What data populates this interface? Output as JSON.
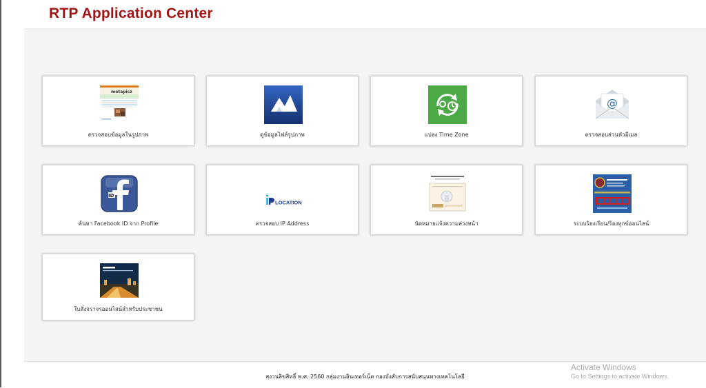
{
  "header": {
    "title": "RTP Application Center"
  },
  "apps": [
    {
      "label": "ตรวจสอบข้อมูลในรูปภาพ",
      "icon": "image-metadata-thumbnail-icon"
    },
    {
      "label": "ดูข้อมูลไฟล์รูปภาพ",
      "icon": "mountain-photo-icon"
    },
    {
      "label": "แปลง Time Zone",
      "icon": "clock-sync-icon"
    },
    {
      "label": "ตรวจสอบส่วนหัวอีเมล",
      "icon": "email-envelope-icon"
    },
    {
      "label": "ค้นหา Facebook ID จาก Profile",
      "icon": "facebook-icon"
    },
    {
      "label": "ตรวจสอบ IP Address",
      "icon": "ip-location-logo-icon",
      "logo_text": "LOCATION"
    },
    {
      "label": "นัดหมายแจ้งความล่วงหน้า",
      "icon": "appointment-form-thumbnail-icon"
    },
    {
      "label": "ระบบร้องเรียน/ร้องทุกข์ออนไลน์",
      "icon": "complaint-system-thumbnail-icon"
    },
    {
      "label": "ใบสั่งจราจรออนไลน์สำหรับประชาชน",
      "icon": "e-ticket-thumbnail-icon"
    }
  ],
  "footer": {
    "copyright": "สงวนลิขสิทธิ์ พ.ศ. 2560 กลุ่มงานอินเทอร์เน็ต กองบังคับการสนับสนุนทางเทคโนโลยี"
  },
  "watermark": {
    "title": "Activate Windows",
    "subtitle": "Go to Settings to activate Windows."
  },
  "colors": {
    "title": "#a31515",
    "time_zone_green": "#4aa845",
    "photo_blue": "#1f3f8f",
    "facebook_blue": "#3b5998"
  }
}
